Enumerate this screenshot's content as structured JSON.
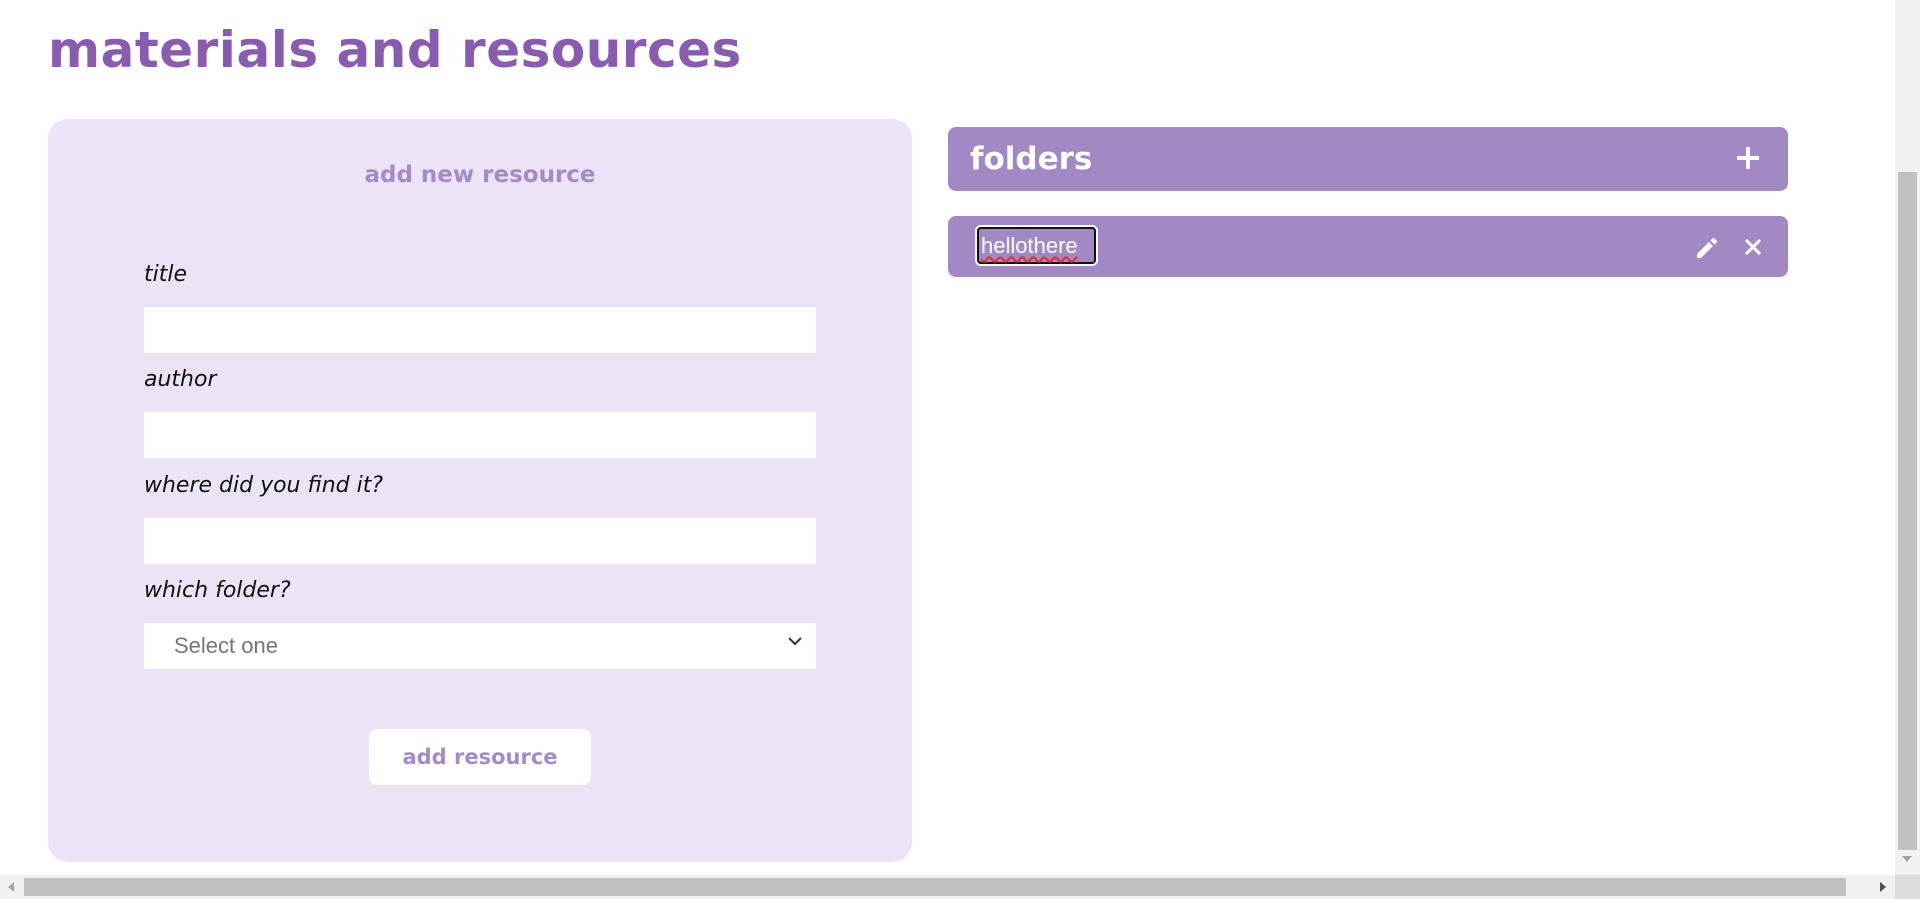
{
  "page": {
    "title": "materials and resources"
  },
  "form": {
    "heading": "add new resource",
    "fields": [
      {
        "label": "title",
        "value": ""
      },
      {
        "label": "author",
        "value": ""
      },
      {
        "label": "where did you find it?",
        "value": ""
      }
    ],
    "folder_select": {
      "label": "which folder?",
      "selected": "Select one"
    },
    "submit_label": "add resource"
  },
  "folders": {
    "title": "folders",
    "items": [
      {
        "name": "hellothere"
      }
    ]
  },
  "colors": {
    "title_purple": "#8a5cb0",
    "panel_bg": "#ece3f7",
    "accent_purple": "#a389c4",
    "muted_purple_text": "#a58ac8"
  },
  "icons": {
    "add_folder": "plus-icon",
    "edit_folder": "pencil-icon",
    "delete_folder": "close-icon",
    "select_dropdown": "chevron-down-icon"
  }
}
